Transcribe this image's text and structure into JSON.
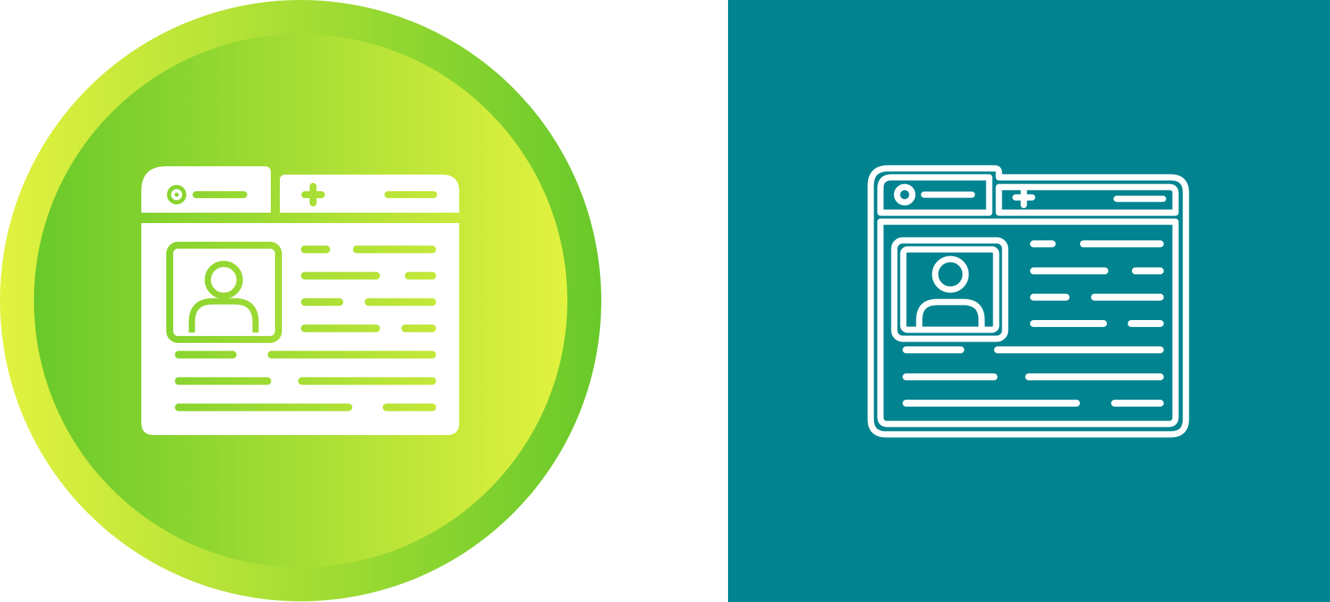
{
  "colors": {
    "background": "#ffffff",
    "teal_panel": "#028490",
    "gradient_lime": "#e2f23f",
    "gradient_green": "#69c92a",
    "glyph_white": "#ffffff"
  },
  "icons": {
    "left": "browser-profile-glyph-icon",
    "right": "browser-profile-outline-icon"
  }
}
